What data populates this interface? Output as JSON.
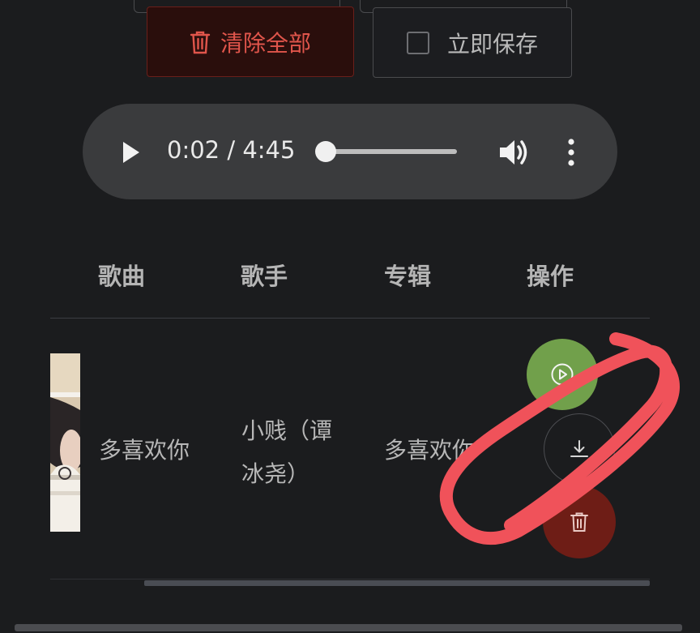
{
  "toolbar": {
    "clear_all_label": "清除全部",
    "save_now_label": "立即保存",
    "save_now_checked": false
  },
  "player": {
    "current_time": "0:02",
    "duration": "4:45",
    "time_display": "0:02 / 4:45",
    "progress": 0.007
  },
  "table": {
    "headers": {
      "song": "歌曲",
      "artist": "歌手",
      "album": "专辑",
      "actions": "操作"
    },
    "rows": [
      {
        "song": "多喜欢你",
        "artist_line1": "小贱（谭",
        "artist_line2": "冰尧）",
        "album": "多喜欢你"
      }
    ]
  },
  "colors": {
    "background": "#1b1c1e",
    "danger": "#e0554b",
    "play_green": "#71a04b",
    "delete_red": "#6e1d16",
    "annotation": "#f0525a"
  },
  "icons": [
    "trash-icon",
    "play-icon",
    "volume-icon",
    "more-vert-icon",
    "play-circle-icon",
    "download-icon",
    "trash-icon"
  ]
}
